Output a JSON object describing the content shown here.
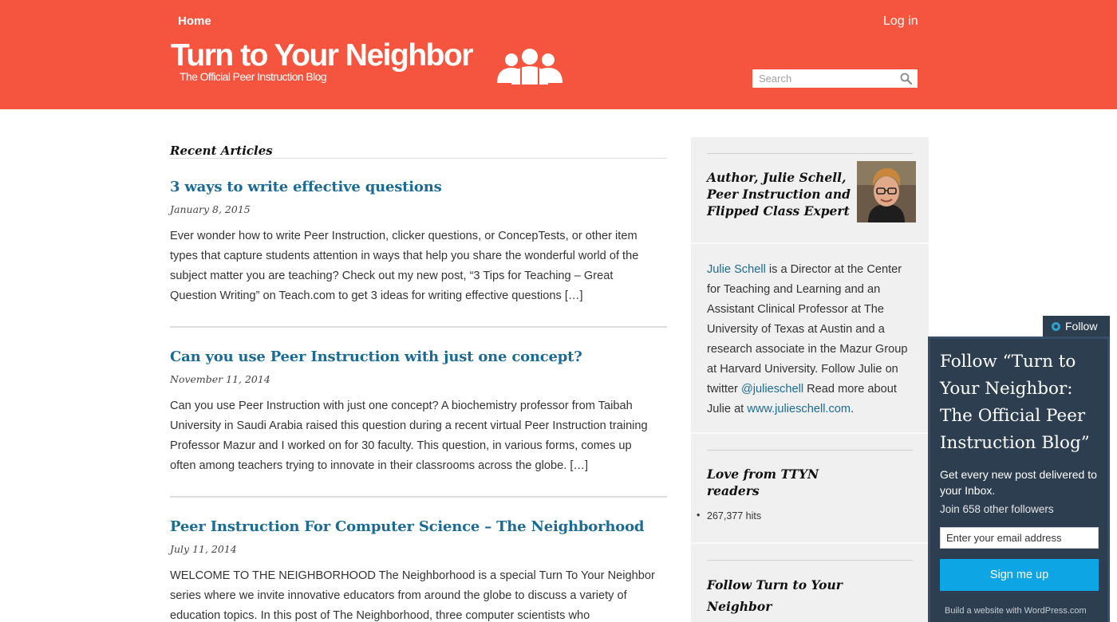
{
  "header": {
    "nav_home": "Home",
    "nav_login": "Log in",
    "site_title": "Turn to Your Neighbor",
    "site_tagline": "The Official Peer Instruction Blog",
    "search_placeholder": "Search",
    "bg_color": "#f5543e"
  },
  "main": {
    "section_heading": "Recent Articles",
    "articles": [
      {
        "title": "3 ways to write effective questions",
        "date": "January 8, 2015",
        "excerpt": "Ever wonder how to write Peer Instruction, clicker questions, or ConcepTests, or other item types that capture students attention in ways that help you share the wonderful world of the subject matter you are teaching? Check out my new post, “3 Tips for Teaching – Great Question Writing” on Teach.com to get 3 ideas for writing effective questions […]"
      },
      {
        "title": "Can you use Peer Instruction with just one concept?",
        "date": "November 11, 2014",
        "excerpt": "Can you use Peer Instruction with just one concept? A biochemistry professor from Taibah University in Saudi Arabia raised this question during a recent virtual Peer Instruction training Professor Mazur and I worked on for 30 faculty. This question, in various forms, comes up often among teachers trying to innovate in their classrooms across the globe. […]"
      },
      {
        "title": "Peer Instruction For Computer Science – The Neighborhood",
        "date": "July 11, 2014",
        "excerpt": "WELCOME TO THE NEIGHBORHOOD  The Neighborhood is a special  Turn To Your Neighbor series where we invite innovative educators from around the globe to discuss a variety of education topics.    In this post of The Neighborhood, three computer scientists who"
      }
    ]
  },
  "sidebar": {
    "author_heading": "Author, Julie Schell, Peer Instruction and Flipped Class Expert",
    "bio": {
      "name_link": "Julie Schell",
      "text1": " is a Director at the Center for Teaching and Learning and an Assistant Clinical Professor at The University of Texas at Austin and a research associate in the Mazur Group at Harvard University. Follow Julie on twitter ",
      "twitter_link": "@julieschell",
      "text2": " Read more about Julie at ",
      "site_link": "www.julieschell.com",
      "text3": "."
    },
    "love_heading": "Love from TTYN readers",
    "hits": "267,377 hits",
    "follow_heading": "Follow Turn to Your Neighbor"
  },
  "follow_widget": {
    "tab_label": "Follow",
    "title": "Follow “Turn to Your Neighbor: The Official Peer Instruction Blog”",
    "description": "Get every new post delivered to your Inbox.",
    "followers": "Join 658 other followers",
    "email_placeholder": "Enter your email address",
    "signup_label": "Sign me up",
    "credit": "Build a website with WordPress.com"
  },
  "colors": {
    "header": "#f5543e",
    "link": "#1b6b94",
    "widget_bg": "#2c3e50",
    "button": "#0da5e3"
  }
}
